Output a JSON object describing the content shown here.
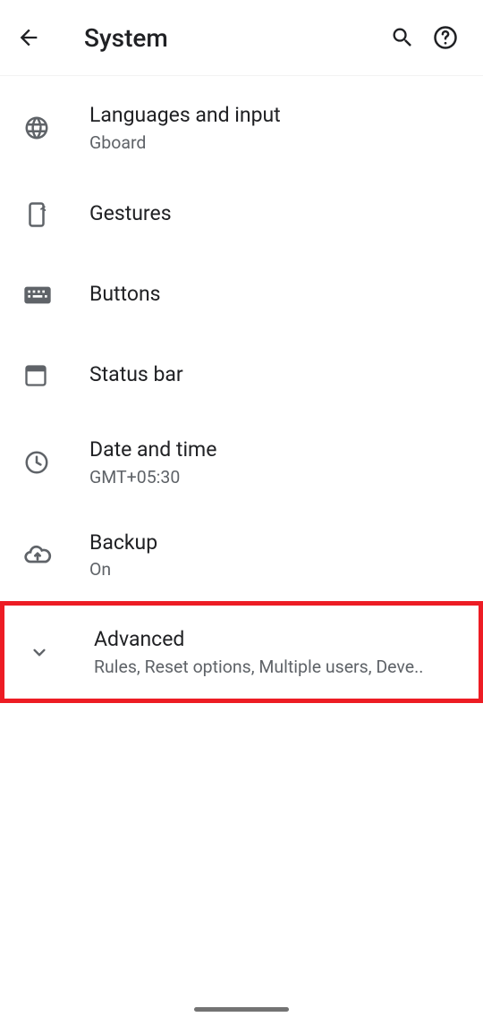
{
  "header": {
    "title": "System"
  },
  "items": [
    {
      "label": "Languages and input",
      "sub": "Gboard"
    },
    {
      "label": "Gestures",
      "sub": ""
    },
    {
      "label": "Buttons",
      "sub": ""
    },
    {
      "label": "Status bar",
      "sub": ""
    },
    {
      "label": "Date and time",
      "sub": "GMT+05:30"
    },
    {
      "label": "Backup",
      "sub": "On"
    },
    {
      "label": "Advanced",
      "sub": "Rules, Reset options, Multiple users, Deve.."
    }
  ]
}
